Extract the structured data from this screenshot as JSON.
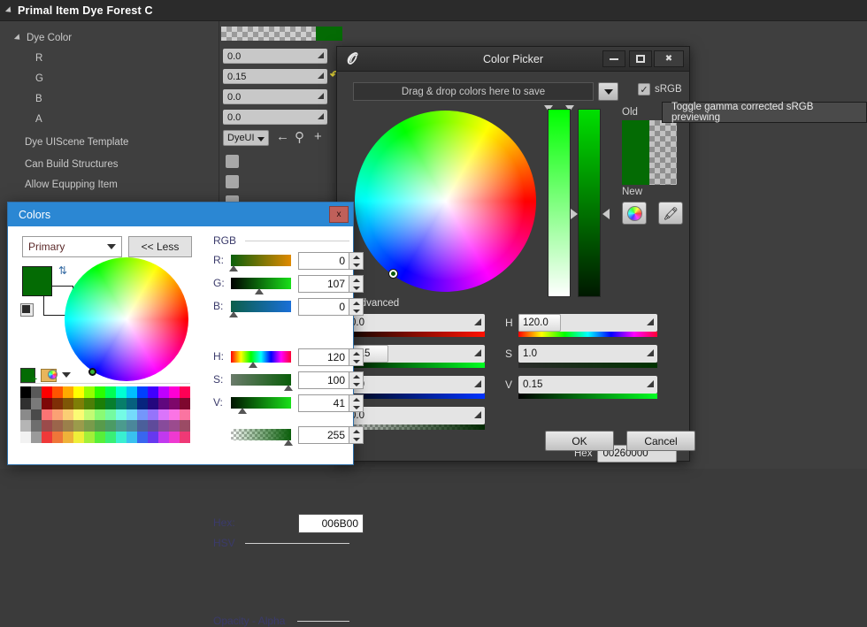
{
  "property_panel": {
    "title": "Primal Item Dye Forest C",
    "group_label": "Dye Color",
    "rows": [
      {
        "label": "R",
        "value": "0.0"
      },
      {
        "label": "G",
        "value": "0.15"
      },
      {
        "label": "B",
        "value": "0.0"
      },
      {
        "label": "A",
        "value": "0.0"
      }
    ],
    "template_row": {
      "label": "Dye UIScene Template",
      "value": "DyeUI"
    },
    "bool_rows": [
      {
        "label": "Can Build Structures"
      },
      {
        "label": "Allow Equpping Item"
      }
    ]
  },
  "color_picker": {
    "title": "Color Picker",
    "save_strip_label": "Drag & drop colors here to save",
    "srgb_label": "sRGB",
    "old_label": "Old",
    "new_label": "New",
    "advanced_label": "Advanced",
    "tooltip": "Toggle gamma corrected sRGB previewing",
    "rgba_sliders": [
      {
        "value": "0.0"
      },
      {
        "value": "0.15"
      },
      {
        "value": "0.0"
      },
      {
        "value": "0.0"
      }
    ],
    "hsv_sliders": [
      {
        "label": "H",
        "value": "120.0"
      },
      {
        "label": "S",
        "value": "1.0"
      },
      {
        "label": "V",
        "value": "0.15"
      }
    ],
    "hex_label": "Hex",
    "hex_value": "00260000",
    "ok_label": "OK",
    "cancel_label": "Cancel",
    "swatch_color": "#046b04"
  },
  "colors_dialog": {
    "title": "Colors",
    "close_label": "x",
    "mode": "Primary",
    "less_label": "<< Less",
    "rgb_group": "RGB",
    "hsv_group": "HSV",
    "opacity_group": "Opacity - Alpha",
    "rgb": [
      {
        "label": "R:",
        "value": "0"
      },
      {
        "label": "G:",
        "value": "107"
      },
      {
        "label": "B:",
        "value": "0"
      }
    ],
    "hex_label": "Hex:",
    "hex_value": "006B00",
    "hsv": [
      {
        "label": "H:",
        "value": "120"
      },
      {
        "label": "S:",
        "value": "100"
      },
      {
        "label": "V:",
        "value": "41"
      }
    ],
    "alpha_value": "255",
    "foreground": "#046b04",
    "background": "#ffffff"
  }
}
